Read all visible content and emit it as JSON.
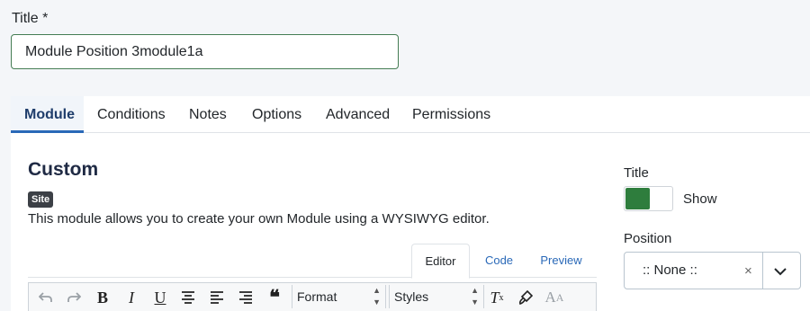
{
  "form": {
    "title_label": "Title *",
    "title_value": "Module Position 3module1a"
  },
  "tabs": [
    {
      "label": "Module",
      "active": true
    },
    {
      "label": "Conditions"
    },
    {
      "label": "Notes"
    },
    {
      "label": "Options"
    },
    {
      "label": "Advanced"
    },
    {
      "label": "Permissions"
    }
  ],
  "module": {
    "heading": "Custom",
    "badge": "Site",
    "description": "This module allows you to create your own Module using a WYSIWYG editor."
  },
  "editor": {
    "tabs": [
      {
        "label": "Editor",
        "active": true
      },
      {
        "label": "Code"
      },
      {
        "label": "Preview"
      }
    ],
    "toolbar": {
      "format_label": "Format",
      "styles_label": "Styles",
      "icons": [
        "undo-icon",
        "redo-icon",
        "bold-icon",
        "italic-icon",
        "underline-icon",
        "align-center-icon",
        "align-left-icon",
        "align-right-icon",
        "blockquote-icon",
        "clear-format-icon",
        "paint-format-icon",
        "font-size-icon"
      ]
    }
  },
  "sidebar": {
    "title_label": "Title",
    "show_label": "Show",
    "show_enabled": true,
    "position_label": "Position",
    "position_value": ":: None ::",
    "clear_symbol": "×"
  },
  "colors": {
    "accent": "#2a69b8",
    "toggle_on": "#2e7d3d",
    "input_border_valid": "#457d54"
  }
}
